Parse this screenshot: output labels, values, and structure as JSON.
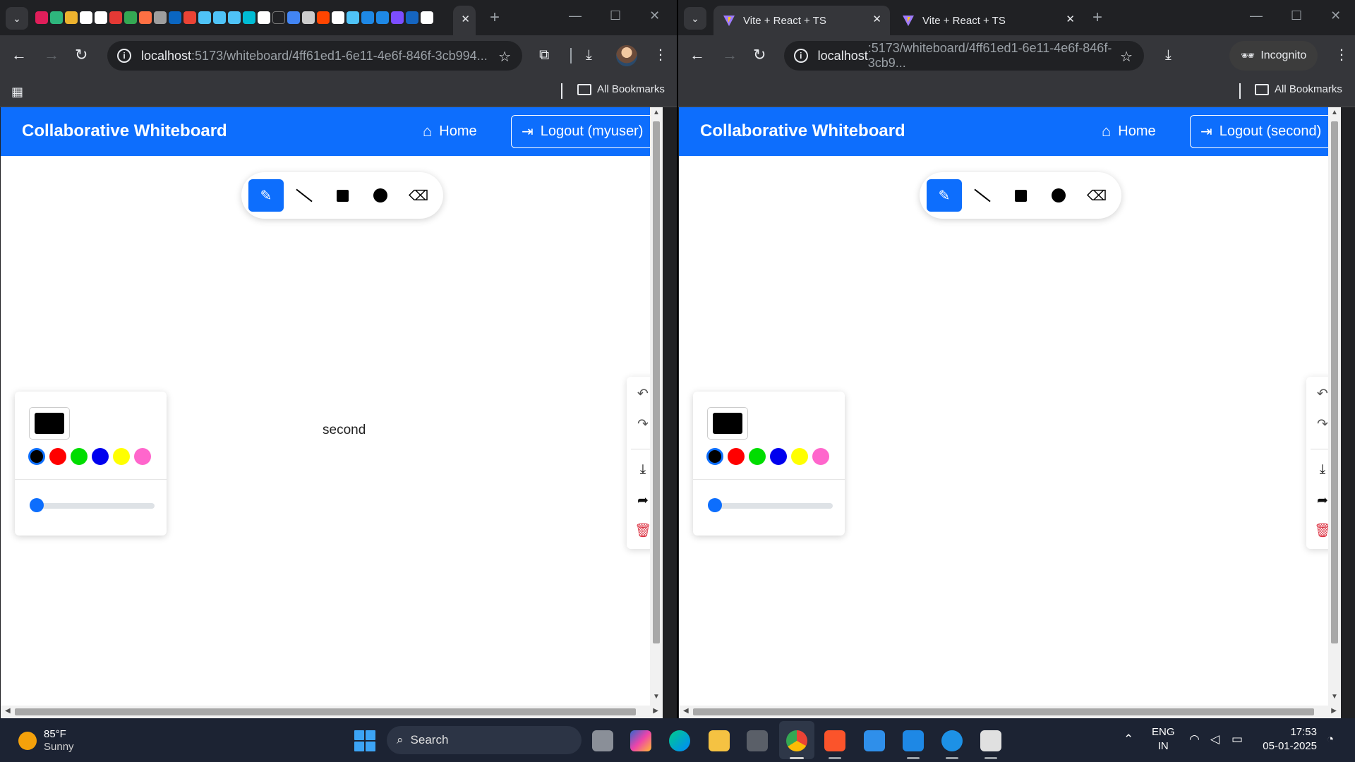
{
  "left_window": {
    "address": {
      "host": "localhost",
      "path": ":5173/whiteboard/4ff61ed1-6e11-4e6f-846f-3cb994..."
    },
    "bookmarks_label": "All Bookmarks",
    "app": {
      "brand": "Collaborative Whiteboard",
      "home_label": "Home",
      "logout_label": "Logout (myuser)",
      "canvas_text": "second"
    }
  },
  "right_window": {
    "tabs": [
      {
        "title": "Vite + React + TS",
        "active": true
      },
      {
        "title": "Vite + React + TS",
        "active": false
      }
    ],
    "address": {
      "host": "localhost",
      "path": ":5173/whiteboard/4ff61ed1-6e11-4e6f-846f-3cb9..."
    },
    "incognito_label": "Incognito",
    "bookmarks_label": "All Bookmarks",
    "app": {
      "brand": "Collaborative Whiteboard",
      "home_label": "Home",
      "logout_label": "Logout (second)"
    }
  },
  "whiteboard": {
    "tools": [
      "pencil-icon",
      "line-icon",
      "rectangle-icon",
      "circle-icon",
      "eraser-icon"
    ],
    "active_tool": "pencil",
    "current_color": "#000000",
    "palette": [
      "#000000",
      "#ff0000",
      "#00dd00",
      "#0000ee",
      "#ffff00",
      "#ff66cc"
    ],
    "brush_size_fraction": 0.05,
    "accent": "#0d6efd",
    "actions": [
      "undo-icon",
      "redo-icon",
      "download-icon",
      "share-icon",
      "trash-icon"
    ]
  },
  "taskbar": {
    "weather": {
      "temp": "85°F",
      "condition": "Sunny"
    },
    "search_label": "Search",
    "language": {
      "line1": "ENG",
      "line2": "IN"
    },
    "clock": {
      "time": "17:53",
      "date": "05-01-2025"
    }
  }
}
